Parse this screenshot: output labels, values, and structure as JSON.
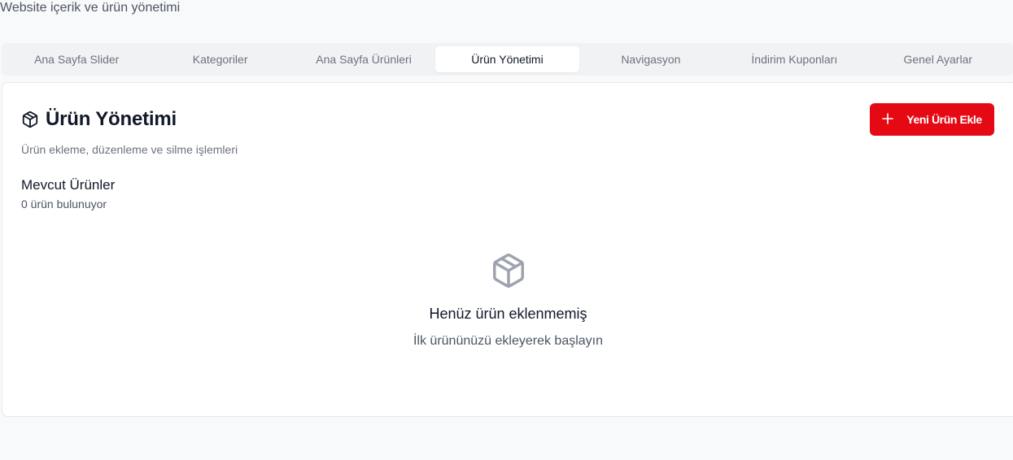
{
  "page": {
    "subtitle": "Website içerik ve ürün yönetimi"
  },
  "tabs": [
    {
      "label": "Ana Sayfa Slider",
      "active": false
    },
    {
      "label": "Kategoriler",
      "active": false
    },
    {
      "label": "Ana Sayfa Ürünleri",
      "active": false
    },
    {
      "label": "Ürün Yönetimi",
      "active": true
    },
    {
      "label": "Navigasyon",
      "active": false
    },
    {
      "label": "İndirim Kuponları",
      "active": false
    },
    {
      "label": "Genel Ayarlar",
      "active": false
    }
  ],
  "card": {
    "icon": "package-icon",
    "title": "Ürün Yönetimi",
    "description": "Ürün ekleme, düzenleme ve silme işlemleri",
    "add_button": {
      "label": "Yeni Ürün Ekle",
      "icon": "plus-icon",
      "color": "#e50914"
    }
  },
  "products": {
    "title": "Mevcut Ürünler",
    "count_text": "0 ürün bulunuyor"
  },
  "empty_state": {
    "icon": "package-icon",
    "title": "Henüz ürün eklenmemiş",
    "description": "İlk ürününüzü ekleyerek başlayın"
  }
}
